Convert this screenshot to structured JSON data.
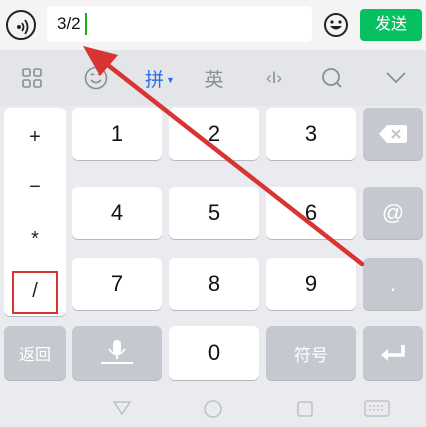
{
  "input_bar": {
    "text_value": "3/2",
    "send_label": "发送"
  },
  "toolbar": {
    "items": [
      {
        "name": "grid-icon",
        "label": ""
      },
      {
        "name": "emoji-icon",
        "label": ""
      },
      {
        "name": "pinyin-mode",
        "label": "拼"
      },
      {
        "name": "english-mode",
        "label": "英"
      },
      {
        "name": "cursor-move-icon",
        "label": "‹I›"
      },
      {
        "name": "search-icon",
        "label": ""
      },
      {
        "name": "collapse-icon",
        "label": ""
      }
    ]
  },
  "keyboard": {
    "symbols": [
      "+",
      "−",
      "*",
      "/"
    ],
    "digits": [
      "1",
      "2",
      "3",
      "4",
      "5",
      "6",
      "7",
      "8",
      "9",
      "0"
    ],
    "back_label": "返回",
    "symbol_label": "符号",
    "at_label": "@",
    "dot_label": "."
  },
  "colors": {
    "send": "#07c160",
    "highlight": "#d93434",
    "arrow": "#d93434",
    "accent": "#2f6fe4"
  }
}
